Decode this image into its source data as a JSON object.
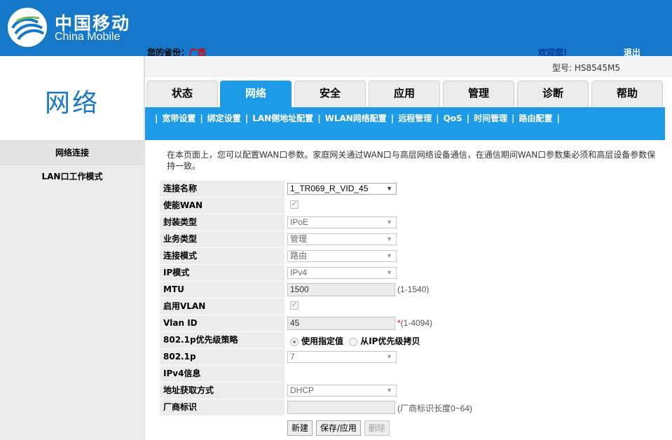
{
  "header": {
    "logo_cn": "中国移动",
    "logo_en": "China Mobile",
    "location_label": "您的省份：",
    "location_value": "广西",
    "welcome": "欢迎您!",
    "logout": "退出"
  },
  "model": "型号: HS8545M5",
  "section_title": "网络",
  "sidebar": {
    "items": [
      {
        "label": "网络连接"
      },
      {
        "label": "LAN口工作模式"
      }
    ]
  },
  "tabs": [
    {
      "label": "状态"
    },
    {
      "label": "网络"
    },
    {
      "label": "安全"
    },
    {
      "label": "应用"
    },
    {
      "label": "管理"
    },
    {
      "label": "诊断"
    },
    {
      "label": "帮助"
    }
  ],
  "subnav": [
    {
      "label": "宽带设置"
    },
    {
      "label": "绑定设置"
    },
    {
      "label": "LAN侧地址配置"
    },
    {
      "label": "WLAN网络配置"
    },
    {
      "label": "远程管理"
    },
    {
      "label": "QoS"
    },
    {
      "label": "时间管理"
    },
    {
      "label": "路由配置"
    }
  ],
  "description": "在本页面上，您可以配置WAN口参数。家庭网关通过WAN口与高层网络设备通信，在通信期间WAN口参数集必须和高层设备参数保持一致。",
  "form": {
    "connection_name": {
      "label": "连接名称",
      "value": "1_TR069_R_VID_45"
    },
    "enable_wan": {
      "label": "使能WAN",
      "checked": true
    },
    "encap_type": {
      "label": "封装类型",
      "value": "IPoE"
    },
    "service_type": {
      "label": "业务类型",
      "value": "管理"
    },
    "connection_mode": {
      "label": "连接模式",
      "value": "路由"
    },
    "ip_mode": {
      "label": "IP模式",
      "value": "IPv4"
    },
    "mtu": {
      "label": "MTU",
      "value": "1500",
      "hint": "(1-1540)"
    },
    "enable_vlan": {
      "label": "启用VLAN",
      "checked": true
    },
    "vlan_id": {
      "label": "Vlan ID",
      "value": "45",
      "required": "*",
      "hint": "(1-4094)"
    },
    "priority_policy": {
      "label": "802.1p优先级策略",
      "option1": "使用指定值",
      "option2": "从IP优先级拷贝",
      "selected": 1
    },
    "dot1p": {
      "label": "802.1p",
      "value": "7"
    },
    "ipv4_info": {
      "label": "IPv4信息"
    },
    "addr_method": {
      "label": "地址获取方式",
      "value": "DHCP"
    },
    "vendor_id": {
      "label": "厂商标识",
      "value": "",
      "hint": "(厂商标识长度0~64)"
    }
  },
  "buttons": {
    "new": "新建",
    "save": "保存/应用",
    "delete": "删除"
  },
  "colors": {
    "header_blue": "#1678c8",
    "tab_active": "#1e9be6",
    "location_red": "#e00000"
  }
}
